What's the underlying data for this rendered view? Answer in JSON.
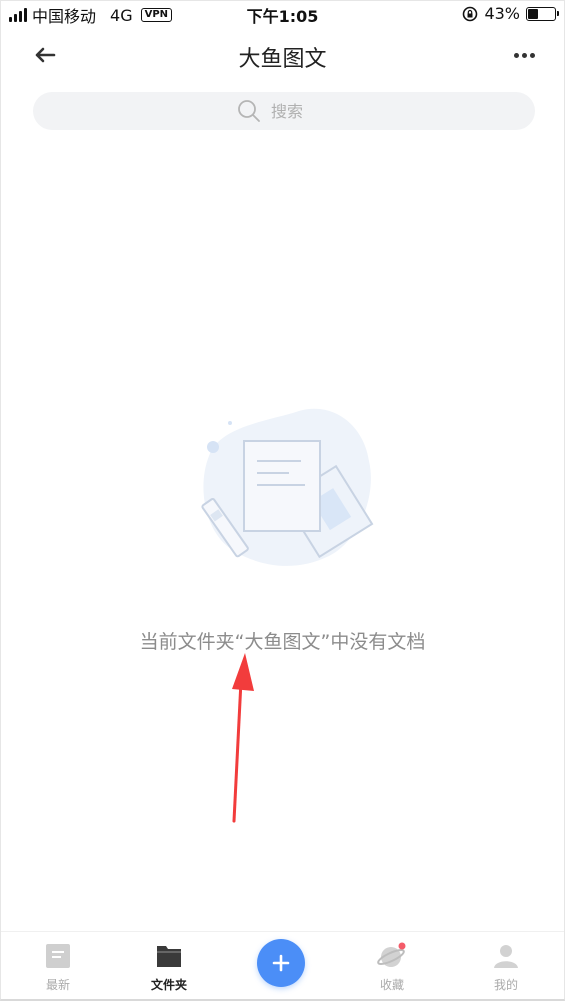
{
  "status_bar": {
    "carrier": "中国移动",
    "network": "4G",
    "vpn": "VPN",
    "time": "下午1:05",
    "battery": "43%",
    "battery_level": 0.43
  },
  "header": {
    "title": "大鱼图文",
    "back_icon": "arrow-left-icon",
    "more_icon": "more-dots-icon"
  },
  "search": {
    "placeholder": "搜索",
    "icon": "search-icon"
  },
  "empty_state": {
    "message": "当前文件夹“大鱼图文”中没有文档",
    "icon": "empty-documents-illustration"
  },
  "tab_bar": {
    "tabs": [
      {
        "label": "最新",
        "icon": "recent-document-icon",
        "active": false
      },
      {
        "label": "文件夹",
        "icon": "folder-icon",
        "active": true
      },
      {
        "label": "收藏",
        "icon": "planet-icon",
        "active": false,
        "badge": true
      },
      {
        "label": "我的",
        "icon": "user-icon",
        "active": false
      }
    ],
    "add_button_icon": "plus-icon"
  },
  "colors": {
    "accent": "#4b8ef7",
    "annotation": "#f23c3c",
    "badge": "#f45b69"
  }
}
